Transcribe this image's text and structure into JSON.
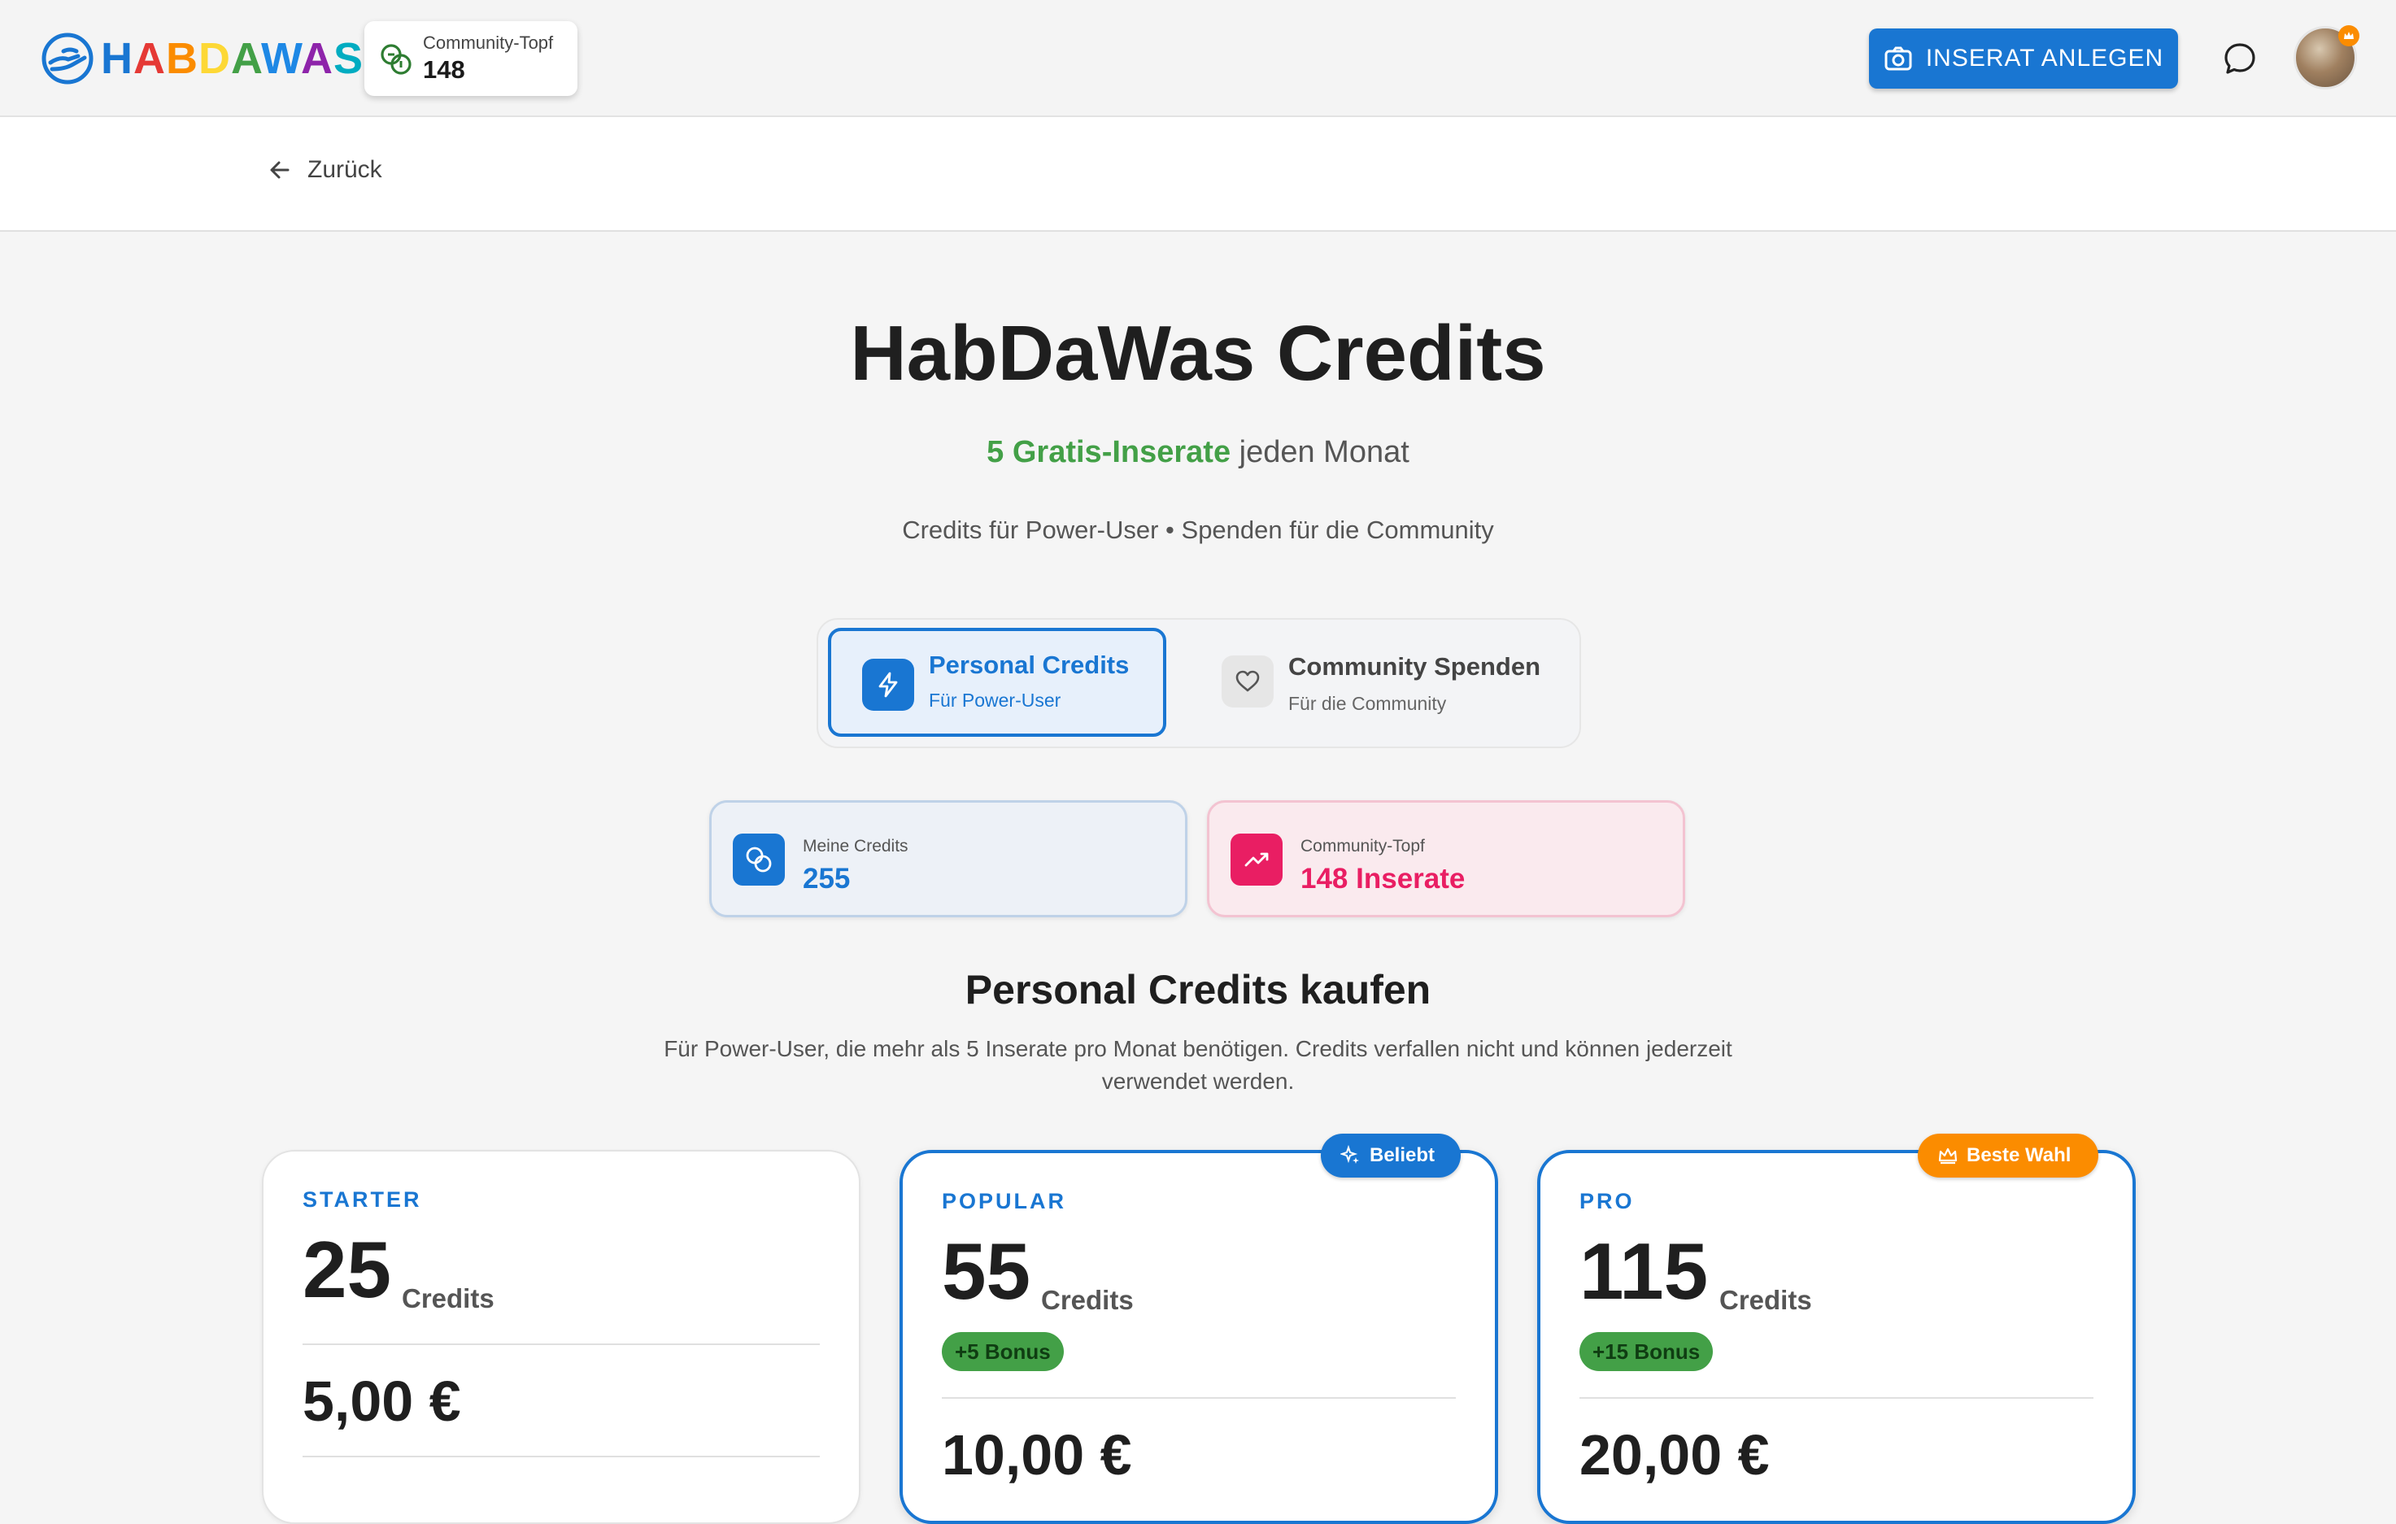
{
  "header": {
    "logo_text": "HABDAWAS",
    "pot_label": "Community-Topf",
    "pot_value": "148",
    "inserat_button": "INSERAT ANLEGEN",
    "colors": {
      "primary": "#1976d2",
      "accent_orange": "#fb8c00"
    }
  },
  "nav": {
    "back_label": "Zurück"
  },
  "hero": {
    "title": "HabDaWas Credits",
    "highlight": "5 Gratis-Inserate",
    "highlight_rest": " jeden Monat",
    "subtitle": "Credits für Power-User • Spenden für die Community"
  },
  "toggle": {
    "personal_title": "Personal Credits",
    "personal_sub": "Für Power-User",
    "community_title": "Community Spenden",
    "community_sub": "Für die Community",
    "selected": "Personal Credits"
  },
  "stats": {
    "mine_label": "Meine Credits",
    "mine_value": "255",
    "pot_label": "Community-Topf",
    "pot_value": "148 Inserate"
  },
  "section": {
    "title": "Personal Credits kaufen",
    "description": "Für Power-User, die mehr als 5 Inserate pro Monat benötigen. Credits verfallen nicht und können jederzeit verwendet werden."
  },
  "packages": [
    {
      "tier": "STARTER",
      "amount": "25",
      "unit": "Credits",
      "bonus": "",
      "price": "5,00 €"
    },
    {
      "tier": "POPULAR",
      "amount": "55",
      "unit": "Credits",
      "bonus": "+5 Bonus",
      "price": "10,00 €",
      "badge": "Beliebt"
    },
    {
      "tier": "PRO",
      "amount": "115",
      "unit": "Credits",
      "bonus": "+15 Bonus",
      "price": "20,00 €",
      "badge": "Beste Wahl"
    }
  ]
}
